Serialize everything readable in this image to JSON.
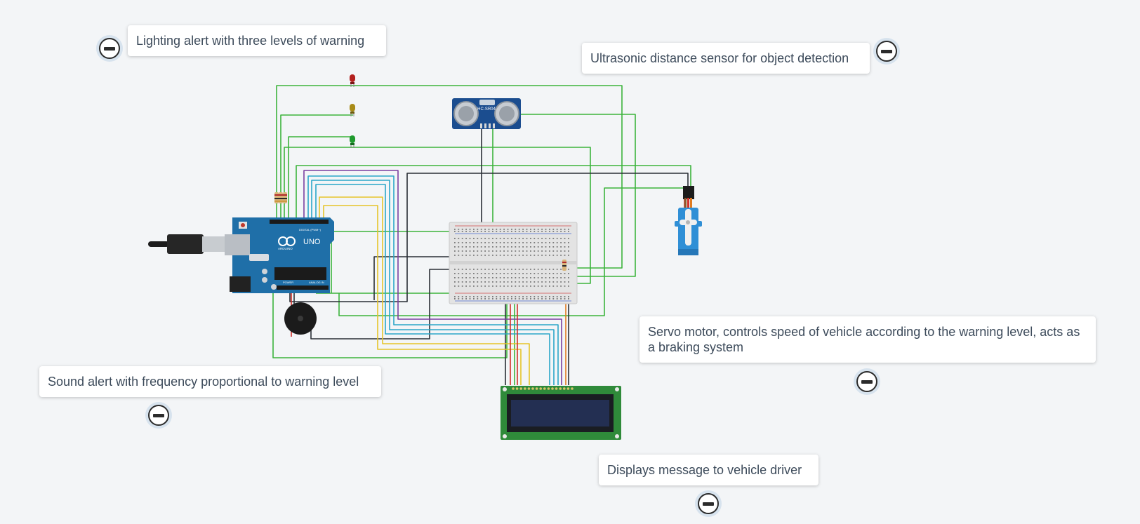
{
  "annotations": [
    {
      "id": "led",
      "text": "Lighting alert with three levels of warning"
    },
    {
      "id": "ultrasonic",
      "text": "Ultrasonic distance sensor for object detection"
    },
    {
      "id": "servo",
      "text": "Servo motor, controls speed of vehicle according to the warning level, acts as a braking system"
    },
    {
      "id": "buzzer",
      "text": "Sound alert with frequency proportional to warning level"
    },
    {
      "id": "lcd",
      "text": "Displays message to vehicle driver"
    }
  ],
  "components": {
    "sensor_label": "HC-SR04",
    "arduino_label": "UNO",
    "arduino_brand": "ARDUINO",
    "arduino_digital": "DIGITAL (PWM~)",
    "arduino_power": "POWER",
    "arduino_analog": "ANALOG IN"
  },
  "colors": {
    "wire_green": "#3cb43c",
    "wire_black": "#2a2f36",
    "wire_purple": "#7a3fa0",
    "wire_cyan": "#2aa6c8",
    "wire_yellow": "#e6c42a",
    "wire_red": "#d0302a",
    "wire_orange": "#e07b20",
    "arduino_blue": "#1f6fa8",
    "pcb_green": "#2f8a3a"
  }
}
